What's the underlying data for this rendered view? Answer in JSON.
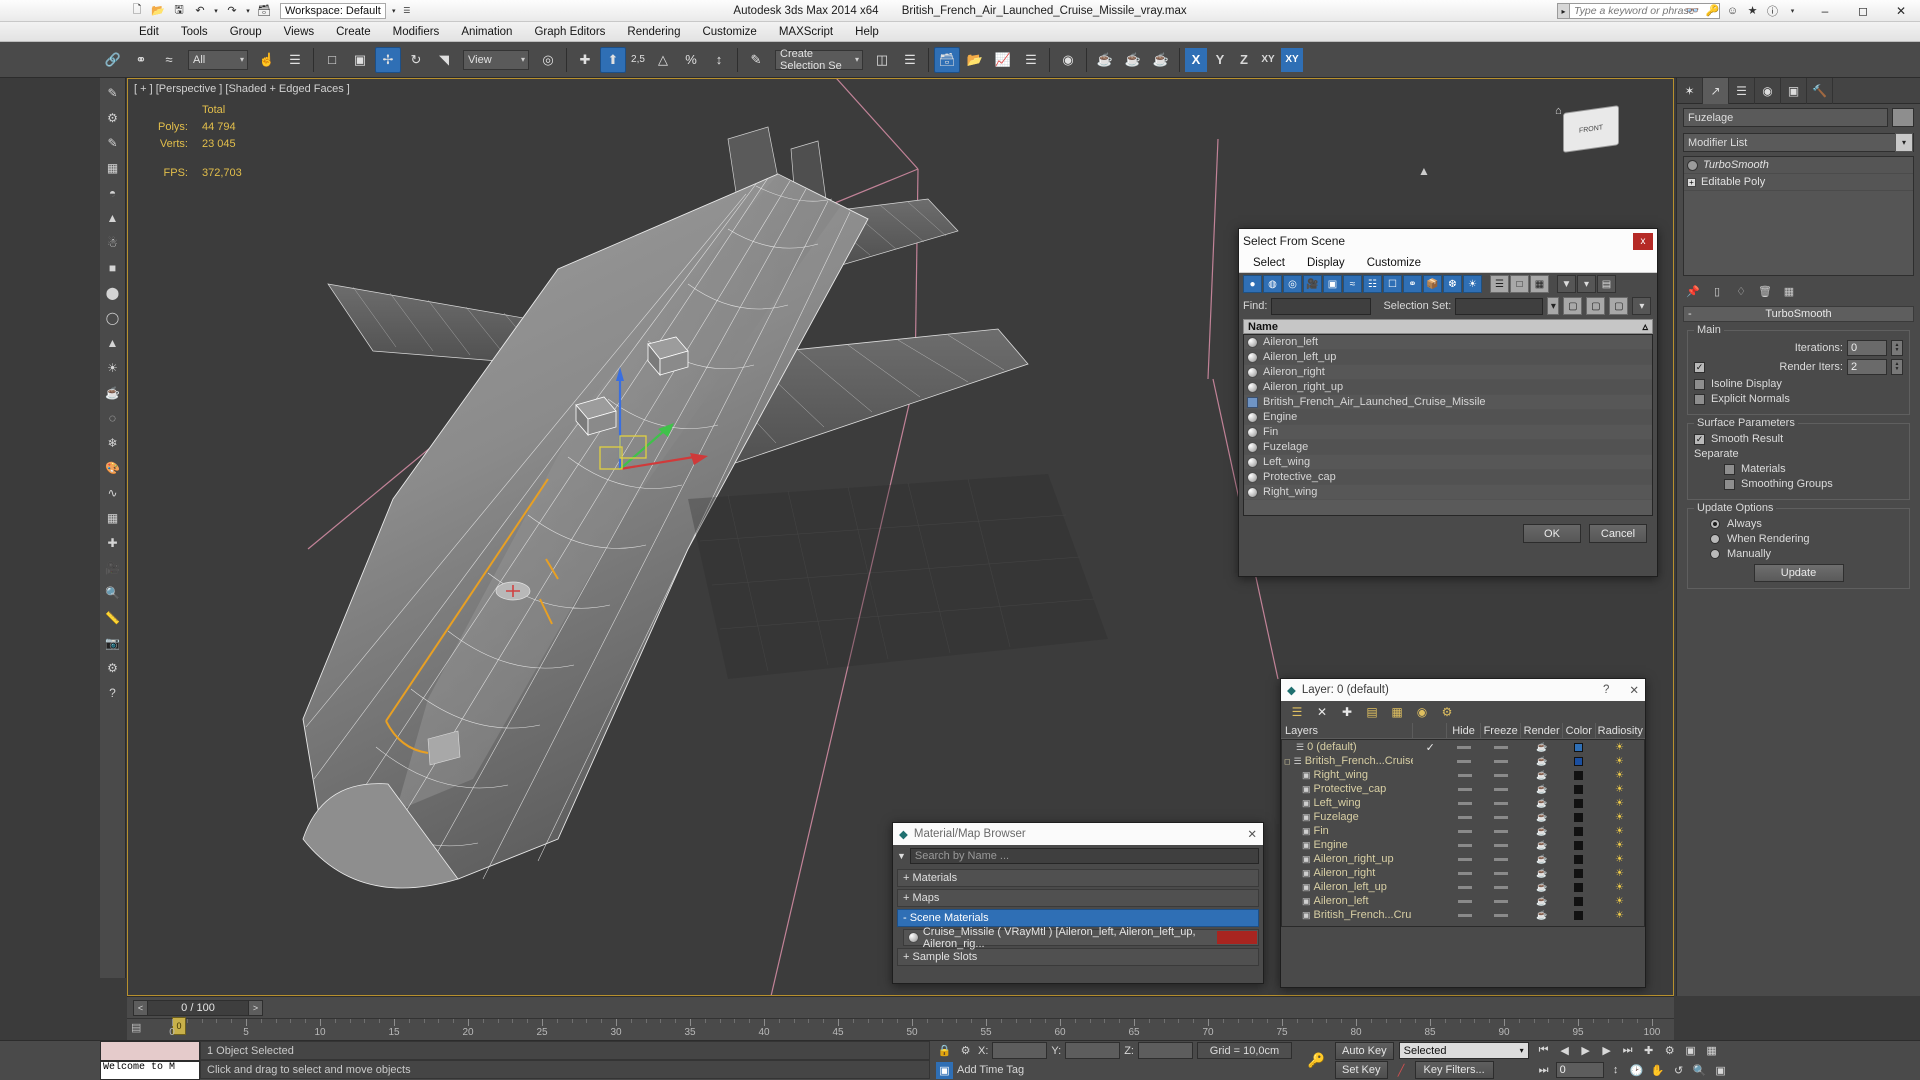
{
  "titlebar": {
    "workspace": "Workspace: Default",
    "app_title": "Autodesk 3ds Max  2014 x64",
    "file_title": "British_French_Air_Launched_Cruise_Missile_vray.max",
    "search_placeholder": "Type a keyword or phrase",
    "quick_access": [
      "new-icon",
      "open-icon",
      "save-icon",
      "undo-icon",
      "redo-icon",
      "setproject-icon"
    ],
    "window_buttons": [
      "minimize",
      "maximize",
      "close"
    ]
  },
  "menu": {
    "items": [
      "Edit",
      "Tools",
      "Group",
      "Views",
      "Create",
      "Modifiers",
      "Animation",
      "Graph Editors",
      "Rendering",
      "Customize",
      "MAXScript",
      "Help"
    ]
  },
  "toolbar": {
    "selection_filter": "All",
    "reference_coord": "View",
    "named_selection_set": "Create Selection Se",
    "snap_percent": "2,5",
    "axis_buttons": [
      "X",
      "Y",
      "Z",
      "XY"
    ]
  },
  "viewport": {
    "label": "[ + ] [Perspective ] [Shaded + Edged Faces ]",
    "stats_header": "Total",
    "stats": [
      {
        "label": "Polys:",
        "value": "44 794"
      },
      {
        "label": "Verts:",
        "value": "23 045"
      }
    ],
    "fps_label": "FPS:",
    "fps_value": "372,703",
    "viewcube_face": "FRONT"
  },
  "select_dialog": {
    "title": "Select From Scene",
    "close_label": "x",
    "menu": [
      "Select",
      "Display",
      "Customize"
    ],
    "find_label": "Find:",
    "find_value": "",
    "selection_set_label": "Selection Set:",
    "selection_set_value": "",
    "column_header": "Name",
    "sort_arrow": "▵",
    "objects": [
      {
        "name": "Aileron_left",
        "icon": "sphere-icon"
      },
      {
        "name": "Aileron_left_up",
        "icon": "sphere-icon"
      },
      {
        "name": "Aileron_right",
        "icon": "sphere-icon"
      },
      {
        "name": "Aileron_right_up",
        "icon": "sphere-icon"
      },
      {
        "name": "British_French_Air_Launched_Cruise_Missile",
        "icon": "group-icon"
      },
      {
        "name": "Engine",
        "icon": "sphere-icon"
      },
      {
        "name": "Fin",
        "icon": "sphere-icon"
      },
      {
        "name": "Fuzelage",
        "icon": "sphere-icon"
      },
      {
        "name": "Left_wing",
        "icon": "sphere-icon"
      },
      {
        "name": "Protective_cap",
        "icon": "sphere-icon"
      },
      {
        "name": "Right_wing",
        "icon": "sphere-icon"
      }
    ],
    "ok_label": "OK",
    "cancel_label": "Cancel"
  },
  "layer_dialog": {
    "title": "Layer: 0 (default)",
    "help_label": "?",
    "close_label": "✕",
    "columns": [
      "Layers",
      "",
      "Hide",
      "Freeze",
      "Render",
      "Color",
      "Radiosity"
    ],
    "rows": [
      {
        "name": "0 (default)",
        "indent": 1,
        "icon": "layer-icon",
        "current": true,
        "color": "#2f6fb5"
      },
      {
        "name": "British_French...Cruise_",
        "indent": 0,
        "icon": "layer-icon",
        "current": false,
        "color": "#1b4fa0",
        "expandable": true
      },
      {
        "name": "Right_wing",
        "indent": 2,
        "icon": "object-icon",
        "color": "#000000"
      },
      {
        "name": "Protective_cap",
        "indent": 2,
        "icon": "object-icon",
        "color": "#000000"
      },
      {
        "name": "Left_wing",
        "indent": 2,
        "icon": "object-icon",
        "color": "#000000"
      },
      {
        "name": "Fuzelage",
        "indent": 2,
        "icon": "object-icon",
        "color": "#000000"
      },
      {
        "name": "Fin",
        "indent": 2,
        "icon": "object-icon",
        "color": "#000000"
      },
      {
        "name": "Engine",
        "indent": 2,
        "icon": "object-icon",
        "color": "#000000"
      },
      {
        "name": "Aileron_right_up",
        "indent": 2,
        "icon": "object-icon",
        "color": "#000000"
      },
      {
        "name": "Aileron_right",
        "indent": 2,
        "icon": "object-icon",
        "color": "#000000"
      },
      {
        "name": "Aileron_left_up",
        "indent": 2,
        "icon": "object-icon",
        "color": "#000000"
      },
      {
        "name": "Aileron_left",
        "indent": 2,
        "icon": "object-icon",
        "color": "#000000"
      },
      {
        "name": "British_French...Cru",
        "indent": 2,
        "icon": "object-icon",
        "color": "#000000"
      }
    ]
  },
  "material_browser": {
    "title": "Material/Map Browser",
    "close_label": "✕",
    "search_placeholder": "Search by Name ...",
    "groups": [
      {
        "label": "+ Materials",
        "selected": false
      },
      {
        "label": "+ Maps",
        "selected": false
      },
      {
        "label": "- Scene Materials",
        "selected": true
      }
    ],
    "scene_material": "Cruise_Missile ( VRayMtl ) [Aileron_left, Aileron_left_up, Aileron_rig...",
    "last_group": "+ Sample Slots"
  },
  "command_panel": {
    "tabs": [
      "create-tab",
      "modify-tab",
      "hierarchy-tab",
      "motion-tab",
      "display-tab",
      "utilities-tab"
    ],
    "active_tab_index": 1,
    "object_name": "Fuzelage",
    "modifier_list_label": "Modifier List",
    "stack": [
      {
        "name": "TurboSmooth",
        "italic": true
      },
      {
        "name": "Editable Poly",
        "italic": false
      }
    ],
    "rollup": {
      "title": "TurboSmooth",
      "main_group": "Main",
      "iterations_label": "Iterations:",
      "iterations_value": "0",
      "render_iters_label": "Render Iters:",
      "render_iters_value": "2",
      "render_iters_checked": true,
      "isoline_label": "Isoline Display",
      "isoline_checked": false,
      "explicit_label": "Explicit Normals",
      "explicit_checked": false,
      "surface_group": "Surface Parameters",
      "smooth_result_label": "Smooth Result",
      "smooth_result_checked": true,
      "separate_label": "Separate",
      "materials_label": "Materials",
      "materials_checked": false,
      "smoothing_groups_label": "Smoothing Groups",
      "smoothing_groups_checked": false,
      "update_group": "Update Options",
      "update_options": [
        "Always",
        "When Rendering",
        "Manually"
      ],
      "update_selected": 0,
      "update_button": "Update"
    }
  },
  "timeline": {
    "frame_display": "0 / 100",
    "prev_label": "<",
    "next_label": ">",
    "current_frame": "0",
    "ticks": [
      0,
      5,
      10,
      15,
      20,
      25,
      30,
      35,
      40,
      45,
      50,
      55,
      60,
      65,
      70,
      75,
      80,
      85,
      90,
      95,
      100
    ]
  },
  "statusbar": {
    "mini_listener_text": "Welcome to M",
    "selection_status": "1 Object Selected",
    "prompt": "Click and drag to select and move objects",
    "coord_labels": [
      "X:",
      "Y:",
      "Z:"
    ],
    "coord_values": [
      "",
      "",
      ""
    ],
    "grid_label": "Grid = 10,0cm",
    "add_time_tag": "Add Time Tag",
    "auto_key": "Auto Key",
    "set_key": "Set Key",
    "key_mode": "Selected",
    "key_filters": "Key Filters...",
    "key_value": "0"
  },
  "colors": {
    "accent_blue": "#2f6fb5",
    "panel_gray": "#4a4a4a",
    "viewport_bg": "#3c3c3c",
    "viewport_border": "#b8912e",
    "stat_yellow": "#e3bf4b",
    "grid_pink": "#d98fa8",
    "close_red": "#b52a26"
  }
}
